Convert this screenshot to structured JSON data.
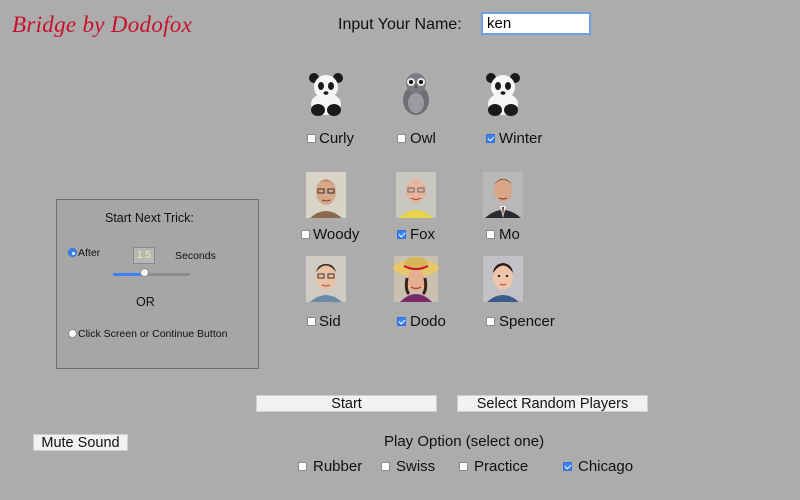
{
  "app_title": "Bridge by Dodofox",
  "name_prompt": "Input Your Name:",
  "name_value": "ken",
  "players": [
    {
      "name": "Curly",
      "checked": false,
      "icon": "panda-avatar"
    },
    {
      "name": "Owl",
      "checked": false,
      "icon": "owl-avatar"
    },
    {
      "name": "Winter",
      "checked": true,
      "icon": "panda-avatar"
    },
    {
      "name": "Woody",
      "checked": false,
      "icon": "man-glasses-avatar"
    },
    {
      "name": "Fox",
      "checked": true,
      "icon": "man-white-hair-avatar"
    },
    {
      "name": "Mo",
      "checked": false,
      "icon": "man-suit-avatar"
    },
    {
      "name": "Sid",
      "checked": false,
      "icon": "boy-glasses-avatar"
    },
    {
      "name": "Dodo",
      "checked": true,
      "icon": "woman-hat-avatar"
    },
    {
      "name": "Spencer",
      "checked": false,
      "icon": "boy-avatar"
    }
  ],
  "trick": {
    "title": "Start Next Trick:",
    "after_label": "After",
    "seconds_value": "1.5",
    "seconds_label": "Seconds",
    "slider_fraction": 0.41,
    "or_label": "OR",
    "click_label": "Click Screen or Continue Button",
    "selected": "after"
  },
  "buttons": {
    "start": "Start",
    "random": "Select Random Players",
    "mute": "Mute Sound"
  },
  "play_option": {
    "title": "Play Option (select one)",
    "options": [
      {
        "label": "Rubber",
        "checked": false
      },
      {
        "label": "Swiss",
        "checked": false
      },
      {
        "label": "Practice",
        "checked": false
      },
      {
        "label": "Chicago",
        "checked": true
      }
    ]
  },
  "colors": {
    "background": "#acacac",
    "title_red": "#c8102e",
    "accent_blue": "#3b82f6",
    "seconds_text": "#f2f29a"
  }
}
